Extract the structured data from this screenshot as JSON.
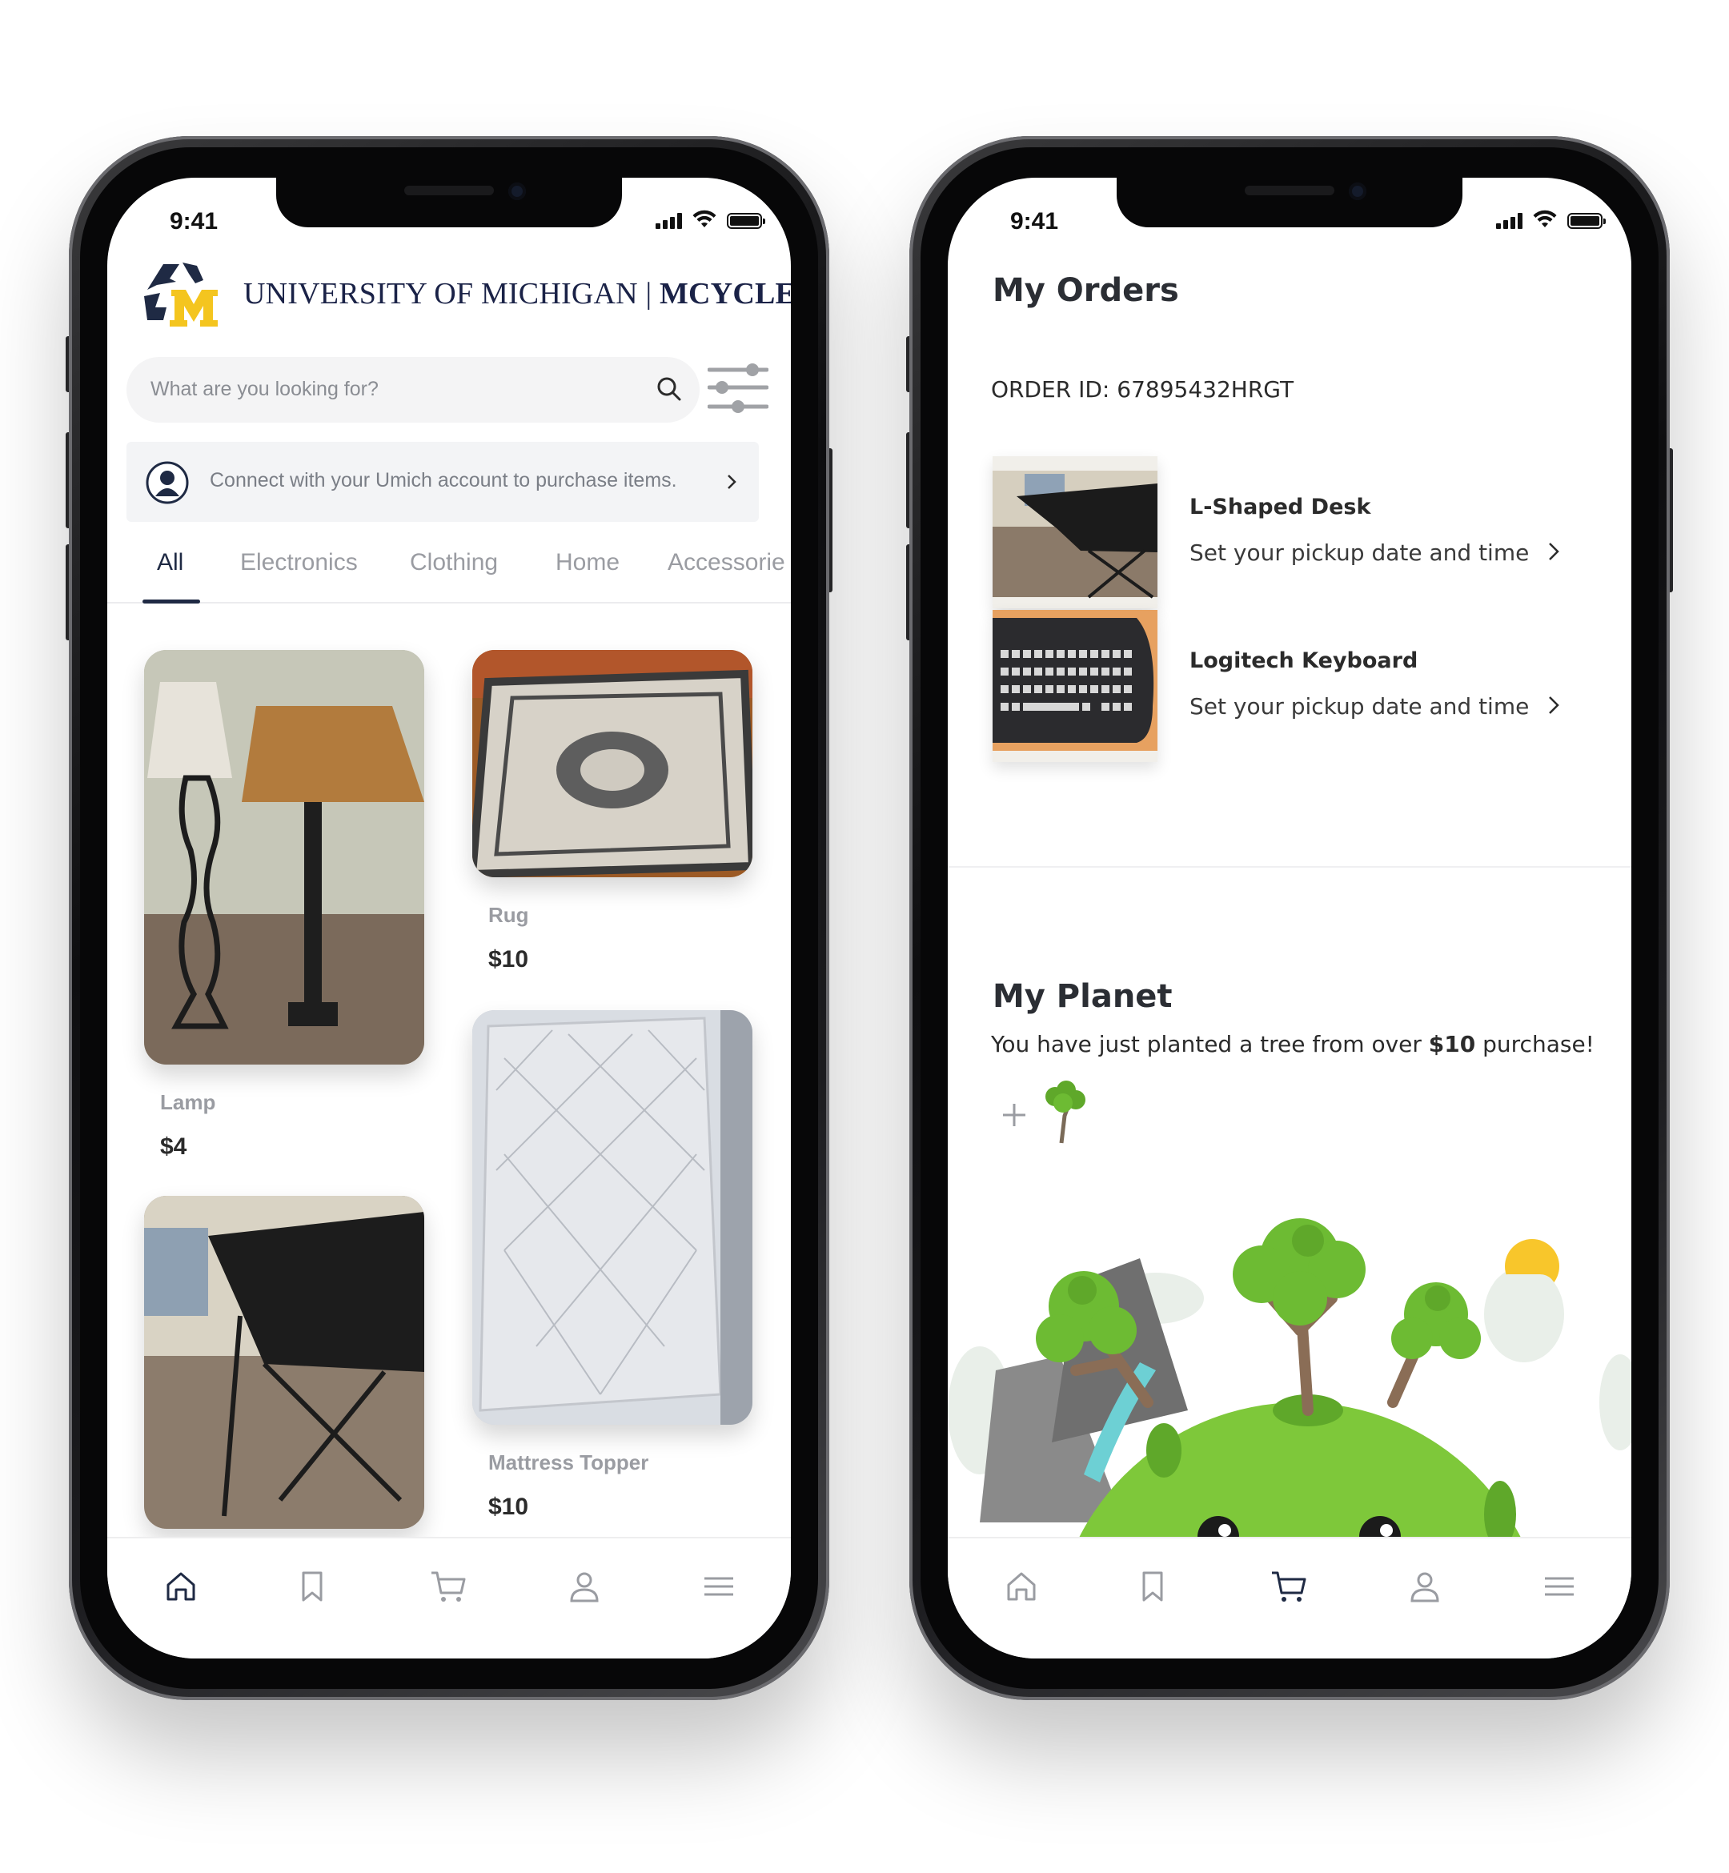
{
  "colors": {
    "brand_navy": "#1f2a44",
    "brand_maize": "#f4c51f",
    "muted_gray": "#9a9ca2",
    "planet_green": "#7ec83a",
    "tree_green": "#5fa82a",
    "water_teal": "#6dd0d4",
    "sun_yellow": "#f8c62b"
  },
  "left_phone": {
    "status": {
      "time": "9:41"
    },
    "header": {
      "logo_icon": "umich-recycle-m-logo",
      "brand_regular": "UNIVERSITY OF MICHIGAN | ",
      "brand_bold": "MCYCLE"
    },
    "search": {
      "placeholder": "What are you looking for?",
      "icon": "search-icon",
      "filter_icon": "filter-sliders-icon"
    },
    "connect_banner": {
      "text": "Connect with your Umich account to purchase items.",
      "icon": "user-avatar-icon"
    },
    "tabs": [
      {
        "label": "All",
        "active": true
      },
      {
        "label": "Electronics"
      },
      {
        "label": "Clothing"
      },
      {
        "label": "Home"
      },
      {
        "label": "Accessorie"
      }
    ],
    "products": [
      {
        "name": "Lamp",
        "price": "$4"
      },
      {
        "name": "Rug",
        "price": "$10"
      },
      {
        "name": "Mattress Topper",
        "price": "$10"
      },
      {
        "name": "",
        "price": ""
      }
    ],
    "bottom_nav": [
      "home-icon",
      "bookmark-icon",
      "cart-icon",
      "profile-icon",
      "menu-icon"
    ],
    "active_nav": "home-icon"
  },
  "right_phone": {
    "status": {
      "time": "9:41"
    },
    "orders": {
      "title": "My Orders",
      "order_id": "ORDER ID: 67895432HRGT",
      "items": [
        {
          "title": "L-Shaped Desk",
          "subtitle": "Set your pickup date and time"
        },
        {
          "title": "Logitech Keyboard",
          "subtitle": "Set your pickup date and time"
        }
      ]
    },
    "planet": {
      "title": "My Planet",
      "text_before": "You have just planted a tree from over ",
      "text_amount": "$10",
      "text_after": " purchase!",
      "add_icon": "plus-icon",
      "tree_icon": "tree-icon",
      "illustration": "smiling-planet-with-trees-illustration"
    },
    "bottom_nav": [
      "home-icon",
      "bookmark-icon",
      "cart-icon",
      "profile-icon",
      "menu-icon"
    ],
    "active_nav": "cart-icon"
  }
}
